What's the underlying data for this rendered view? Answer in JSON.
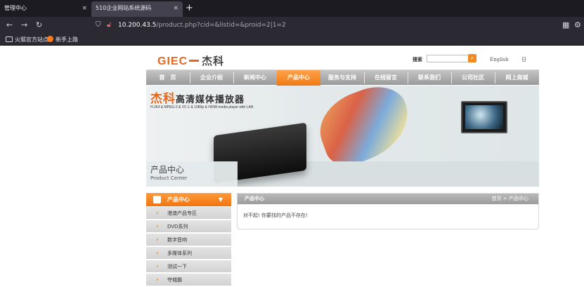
{
  "browser": {
    "tabs": [
      {
        "title": "管理中心"
      },
      {
        "title": "510企业网站系统源码"
      }
    ],
    "new_tab": "+",
    "close": "×",
    "nav": {
      "back": "←",
      "forward": "→",
      "reload": "↻"
    },
    "url": {
      "host": "10.200.43.5",
      "path": "/product.php?cid=&listid=&proid=2|1=2"
    },
    "bookmarks": [
      {
        "label": "火狐官方站点"
      },
      {
        "label": "新手上路"
      }
    ]
  },
  "site": {
    "logo": {
      "en": "GIEC",
      "cn": "杰科"
    },
    "search": {
      "label": "搜索",
      "placeholder": "",
      "button": "⌕"
    },
    "lang": {
      "en": "English",
      "cn": "日"
    },
    "nav": [
      {
        "label": "首　页"
      },
      {
        "label": "企业介绍"
      },
      {
        "label": "新闻中心"
      },
      {
        "label": "产品中心",
        "active": true
      },
      {
        "label": "服务与支持"
      },
      {
        "label": "在线留言"
      },
      {
        "label": "联系我们"
      },
      {
        "label": "公司社区"
      },
      {
        "label": "网上商城"
      }
    ],
    "banner": {
      "title_brand": "杰科",
      "title_rest": "高清媒体播放器",
      "subtitle": "H.264 & MPEG-2 & VC-1 & 1080p & HDMI media player with LAN",
      "caption_cn": "产品中心",
      "caption_en": "Product Center"
    },
    "sidebar": {
      "title": "产品中心",
      "arrow": "▼",
      "items": [
        {
          "label": "港澳产品专区"
        },
        {
          "label": "DVD系列"
        },
        {
          "label": "数字音响"
        },
        {
          "label": "多媒体系列"
        },
        {
          "label": "测试一下"
        },
        {
          "label": "夺城霸"
        }
      ]
    },
    "content": {
      "title": "产品中心",
      "breadcrumb": "首页 > 产品中心",
      "message": "对不起! 你要找的产品不存在!"
    }
  },
  "colors": {
    "accent": "#f07a14",
    "nav_gray": "#a8a8a8",
    "browser_dark": "#1c1b22"
  }
}
